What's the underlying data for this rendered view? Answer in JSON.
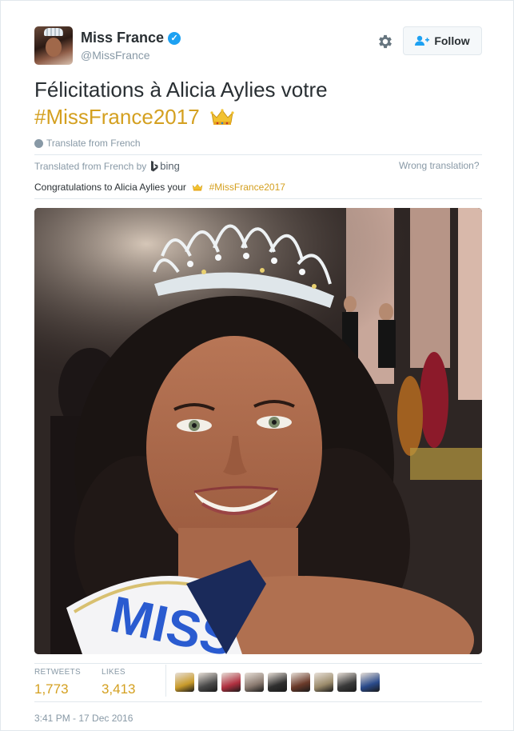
{
  "author": {
    "display_name": "Miss France",
    "handle": "@MissFrance",
    "verified_mark": "✓"
  },
  "actions": {
    "settings_icon": "gear-icon",
    "follow_label": "Follow"
  },
  "tweet": {
    "text": "Félicitations à Alicia Aylies votre",
    "hashtag": "#MissFrance2017",
    "emoji": "crown-emoji"
  },
  "translation": {
    "translate_link": "Translate from French",
    "translated_by": "Translated from French by",
    "provider": "bing",
    "wrong_link": "Wrong translation?",
    "text": "Congratulations to Alicia Aylies your",
    "hashtag": "#MissFrance2017"
  },
  "stats": {
    "retweets_label": "RETWEETS",
    "retweets_value": "1,773",
    "likes_label": "LIKES",
    "likes_value": "3,413"
  },
  "likers": [
    {
      "name": "liker-avatar-1",
      "color": "#c89a2a"
    },
    {
      "name": "liker-avatar-2",
      "color": "#4a4a4a"
    },
    {
      "name": "liker-avatar-3",
      "color": "#b03040"
    },
    {
      "name": "liker-avatar-4",
      "color": "#8a7a70"
    },
    {
      "name": "liker-avatar-5",
      "color": "#2f2f2f"
    },
    {
      "name": "liker-avatar-6",
      "color": "#6a3a2a"
    },
    {
      "name": "liker-avatar-7",
      "color": "#9a8a6a"
    },
    {
      "name": "liker-avatar-8",
      "color": "#3a3a3a"
    },
    {
      "name": "liker-avatar-9",
      "color": "#2a4a8a"
    }
  ],
  "timestamp": "3:41 PM - 17 Dec 2016",
  "colors": {
    "accent": "#d4a020",
    "verified": "#1da1f2",
    "muted": "#8899a6"
  }
}
